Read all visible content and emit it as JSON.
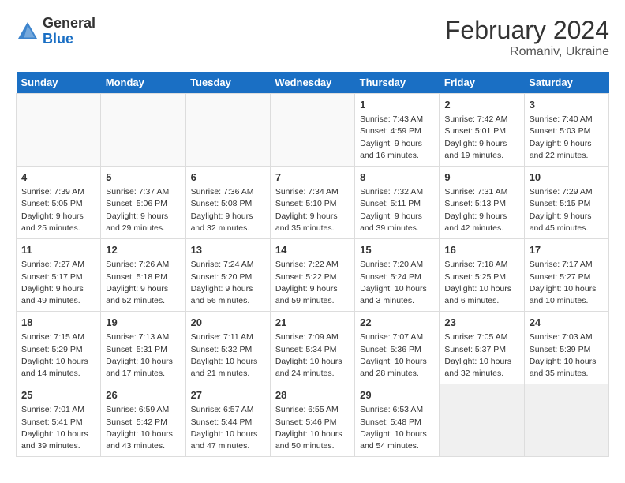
{
  "header": {
    "logo_general": "General",
    "logo_blue": "Blue",
    "month": "February 2024",
    "location": "Romaniv, Ukraine"
  },
  "weekdays": [
    "Sunday",
    "Monday",
    "Tuesday",
    "Wednesday",
    "Thursday",
    "Friday",
    "Saturday"
  ],
  "weeks": [
    [
      {
        "day": "",
        "info": ""
      },
      {
        "day": "",
        "info": ""
      },
      {
        "day": "",
        "info": ""
      },
      {
        "day": "",
        "info": ""
      },
      {
        "day": "1",
        "info": "Sunrise: 7:43 AM\nSunset: 4:59 PM\nDaylight: 9 hours\nand 16 minutes."
      },
      {
        "day": "2",
        "info": "Sunrise: 7:42 AM\nSunset: 5:01 PM\nDaylight: 9 hours\nand 19 minutes."
      },
      {
        "day": "3",
        "info": "Sunrise: 7:40 AM\nSunset: 5:03 PM\nDaylight: 9 hours\nand 22 minutes."
      }
    ],
    [
      {
        "day": "4",
        "info": "Sunrise: 7:39 AM\nSunset: 5:05 PM\nDaylight: 9 hours\nand 25 minutes."
      },
      {
        "day": "5",
        "info": "Sunrise: 7:37 AM\nSunset: 5:06 PM\nDaylight: 9 hours\nand 29 minutes."
      },
      {
        "day": "6",
        "info": "Sunrise: 7:36 AM\nSunset: 5:08 PM\nDaylight: 9 hours\nand 32 minutes."
      },
      {
        "day": "7",
        "info": "Sunrise: 7:34 AM\nSunset: 5:10 PM\nDaylight: 9 hours\nand 35 minutes."
      },
      {
        "day": "8",
        "info": "Sunrise: 7:32 AM\nSunset: 5:11 PM\nDaylight: 9 hours\nand 39 minutes."
      },
      {
        "day": "9",
        "info": "Sunrise: 7:31 AM\nSunset: 5:13 PM\nDaylight: 9 hours\nand 42 minutes."
      },
      {
        "day": "10",
        "info": "Sunrise: 7:29 AM\nSunset: 5:15 PM\nDaylight: 9 hours\nand 45 minutes."
      }
    ],
    [
      {
        "day": "11",
        "info": "Sunrise: 7:27 AM\nSunset: 5:17 PM\nDaylight: 9 hours\nand 49 minutes."
      },
      {
        "day": "12",
        "info": "Sunrise: 7:26 AM\nSunset: 5:18 PM\nDaylight: 9 hours\nand 52 minutes."
      },
      {
        "day": "13",
        "info": "Sunrise: 7:24 AM\nSunset: 5:20 PM\nDaylight: 9 hours\nand 56 minutes."
      },
      {
        "day": "14",
        "info": "Sunrise: 7:22 AM\nSunset: 5:22 PM\nDaylight: 9 hours\nand 59 minutes."
      },
      {
        "day": "15",
        "info": "Sunrise: 7:20 AM\nSunset: 5:24 PM\nDaylight: 10 hours\nand 3 minutes."
      },
      {
        "day": "16",
        "info": "Sunrise: 7:18 AM\nSunset: 5:25 PM\nDaylight: 10 hours\nand 6 minutes."
      },
      {
        "day": "17",
        "info": "Sunrise: 7:17 AM\nSunset: 5:27 PM\nDaylight: 10 hours\nand 10 minutes."
      }
    ],
    [
      {
        "day": "18",
        "info": "Sunrise: 7:15 AM\nSunset: 5:29 PM\nDaylight: 10 hours\nand 14 minutes."
      },
      {
        "day": "19",
        "info": "Sunrise: 7:13 AM\nSunset: 5:31 PM\nDaylight: 10 hours\nand 17 minutes."
      },
      {
        "day": "20",
        "info": "Sunrise: 7:11 AM\nSunset: 5:32 PM\nDaylight: 10 hours\nand 21 minutes."
      },
      {
        "day": "21",
        "info": "Sunrise: 7:09 AM\nSunset: 5:34 PM\nDaylight: 10 hours\nand 24 minutes."
      },
      {
        "day": "22",
        "info": "Sunrise: 7:07 AM\nSunset: 5:36 PM\nDaylight: 10 hours\nand 28 minutes."
      },
      {
        "day": "23",
        "info": "Sunrise: 7:05 AM\nSunset: 5:37 PM\nDaylight: 10 hours\nand 32 minutes."
      },
      {
        "day": "24",
        "info": "Sunrise: 7:03 AM\nSunset: 5:39 PM\nDaylight: 10 hours\nand 35 minutes."
      }
    ],
    [
      {
        "day": "25",
        "info": "Sunrise: 7:01 AM\nSunset: 5:41 PM\nDaylight: 10 hours\nand 39 minutes."
      },
      {
        "day": "26",
        "info": "Sunrise: 6:59 AM\nSunset: 5:42 PM\nDaylight: 10 hours\nand 43 minutes."
      },
      {
        "day": "27",
        "info": "Sunrise: 6:57 AM\nSunset: 5:44 PM\nDaylight: 10 hours\nand 47 minutes."
      },
      {
        "day": "28",
        "info": "Sunrise: 6:55 AM\nSunset: 5:46 PM\nDaylight: 10 hours\nand 50 minutes."
      },
      {
        "day": "29",
        "info": "Sunrise: 6:53 AM\nSunset: 5:48 PM\nDaylight: 10 hours\nand 54 minutes."
      },
      {
        "day": "",
        "info": ""
      },
      {
        "day": "",
        "info": ""
      }
    ]
  ]
}
